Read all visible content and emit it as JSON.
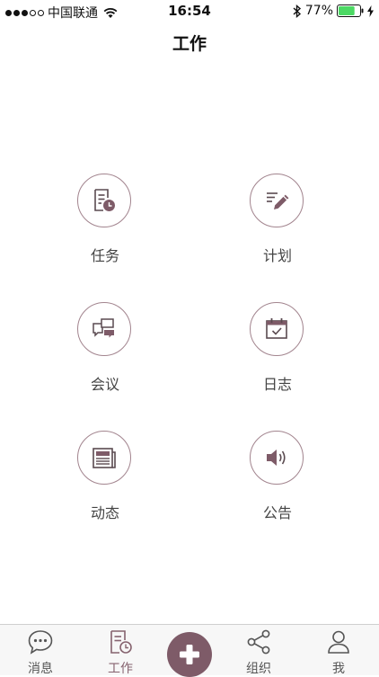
{
  "status_bar": {
    "carrier": "中国联通",
    "time": "16:54",
    "battery_percent": "77%",
    "battery_level": 0.77,
    "signal_bars_filled": 3
  },
  "header": {
    "title": "工作"
  },
  "work_items": [
    {
      "label": "任务",
      "icon": "task-clock-icon"
    },
    {
      "label": "计划",
      "icon": "plan-pencil-icon"
    },
    {
      "label": "会议",
      "icon": "meeting-chat-icon"
    },
    {
      "label": "日志",
      "icon": "log-calendar-icon"
    },
    {
      "label": "动态",
      "icon": "news-feed-icon"
    },
    {
      "label": "公告",
      "icon": "announcement-speaker-icon"
    }
  ],
  "tab_bar": {
    "tabs": [
      {
        "label": "消息",
        "icon": "chat-bubble-icon"
      },
      {
        "label": "工作",
        "icon": "document-clock-icon",
        "active": true
      },
      {
        "label": "",
        "icon": "plus-icon"
      },
      {
        "label": "组织",
        "icon": "share-nodes-icon"
      },
      {
        "label": "我",
        "icon": "person-icon"
      }
    ]
  },
  "colors": {
    "accent": "#7e5b68",
    "icon_stroke": "#5a4a50",
    "circle_border": "#a2848e",
    "battery_green": "#4cd964"
  }
}
